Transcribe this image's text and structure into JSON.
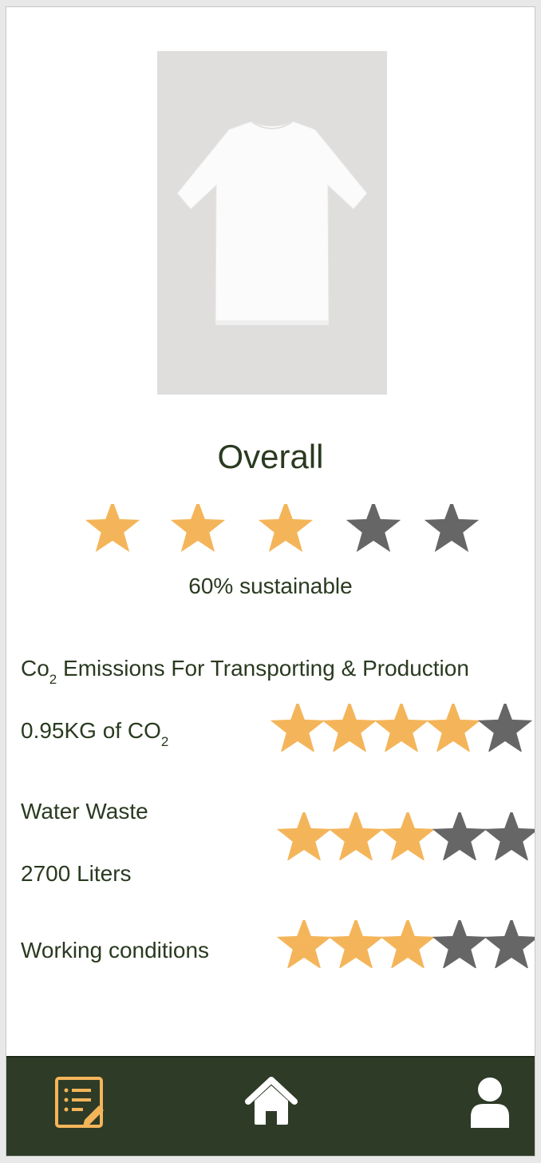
{
  "colors": {
    "star_filled": "#f4b55a",
    "star_empty": "#666666",
    "text": "#2a3a20",
    "nav_bg": "#2e3b27",
    "nav_icon_active": "#f4b55a",
    "nav_icon": "#ffffff"
  },
  "product": {
    "image_icon": "white-tshirt-image"
  },
  "overall": {
    "title": "Overall",
    "rating": 3,
    "max": 5,
    "sustainable_text": "60% sustainable"
  },
  "co2_section": {
    "header_prefix": "Co",
    "header_sub": "2",
    "header_rest": " Emissions For Transporting & Production"
  },
  "metrics": [
    {
      "id": "co2",
      "label_main": "0.95KG of CO",
      "label_sub": "2",
      "rating": 4,
      "max": 5
    },
    {
      "id": "water",
      "label": "Water Waste",
      "value": "2700 Liters",
      "rating": 3,
      "max": 5
    },
    {
      "id": "working",
      "label": "Working conditions",
      "rating": 3,
      "max": 5
    }
  ],
  "nav": {
    "items": [
      {
        "icon": "edit-list-icon"
      },
      {
        "icon": "home-icon"
      },
      {
        "icon": "user-icon"
      }
    ]
  }
}
